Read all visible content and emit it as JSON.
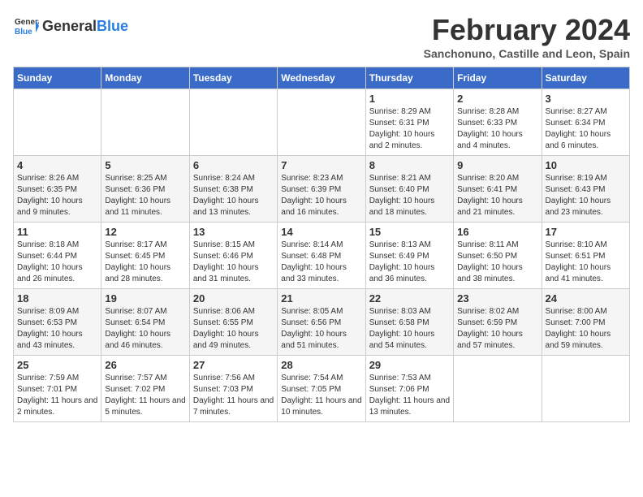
{
  "logo": {
    "general": "General",
    "blue": "Blue"
  },
  "header": {
    "month": "February 2024",
    "location": "Sanchonuno, Castille and Leon, Spain"
  },
  "days_of_week": [
    "Sunday",
    "Monday",
    "Tuesday",
    "Wednesday",
    "Thursday",
    "Friday",
    "Saturday"
  ],
  "weeks": [
    [
      {
        "day": "",
        "info": ""
      },
      {
        "day": "",
        "info": ""
      },
      {
        "day": "",
        "info": ""
      },
      {
        "day": "",
        "info": ""
      },
      {
        "day": "1",
        "info": "Sunrise: 8:29 AM\nSunset: 6:31 PM\nDaylight: 10 hours and 2 minutes."
      },
      {
        "day": "2",
        "info": "Sunrise: 8:28 AM\nSunset: 6:33 PM\nDaylight: 10 hours and 4 minutes."
      },
      {
        "day": "3",
        "info": "Sunrise: 8:27 AM\nSunset: 6:34 PM\nDaylight: 10 hours and 6 minutes."
      }
    ],
    [
      {
        "day": "4",
        "info": "Sunrise: 8:26 AM\nSunset: 6:35 PM\nDaylight: 10 hours and 9 minutes."
      },
      {
        "day": "5",
        "info": "Sunrise: 8:25 AM\nSunset: 6:36 PM\nDaylight: 10 hours and 11 minutes."
      },
      {
        "day": "6",
        "info": "Sunrise: 8:24 AM\nSunset: 6:38 PM\nDaylight: 10 hours and 13 minutes."
      },
      {
        "day": "7",
        "info": "Sunrise: 8:23 AM\nSunset: 6:39 PM\nDaylight: 10 hours and 16 minutes."
      },
      {
        "day": "8",
        "info": "Sunrise: 8:21 AM\nSunset: 6:40 PM\nDaylight: 10 hours and 18 minutes."
      },
      {
        "day": "9",
        "info": "Sunrise: 8:20 AM\nSunset: 6:41 PM\nDaylight: 10 hours and 21 minutes."
      },
      {
        "day": "10",
        "info": "Sunrise: 8:19 AM\nSunset: 6:43 PM\nDaylight: 10 hours and 23 minutes."
      }
    ],
    [
      {
        "day": "11",
        "info": "Sunrise: 8:18 AM\nSunset: 6:44 PM\nDaylight: 10 hours and 26 minutes."
      },
      {
        "day": "12",
        "info": "Sunrise: 8:17 AM\nSunset: 6:45 PM\nDaylight: 10 hours and 28 minutes."
      },
      {
        "day": "13",
        "info": "Sunrise: 8:15 AM\nSunset: 6:46 PM\nDaylight: 10 hours and 31 minutes."
      },
      {
        "day": "14",
        "info": "Sunrise: 8:14 AM\nSunset: 6:48 PM\nDaylight: 10 hours and 33 minutes."
      },
      {
        "day": "15",
        "info": "Sunrise: 8:13 AM\nSunset: 6:49 PM\nDaylight: 10 hours and 36 minutes."
      },
      {
        "day": "16",
        "info": "Sunrise: 8:11 AM\nSunset: 6:50 PM\nDaylight: 10 hours and 38 minutes."
      },
      {
        "day": "17",
        "info": "Sunrise: 8:10 AM\nSunset: 6:51 PM\nDaylight: 10 hours and 41 minutes."
      }
    ],
    [
      {
        "day": "18",
        "info": "Sunrise: 8:09 AM\nSunset: 6:53 PM\nDaylight: 10 hours and 43 minutes."
      },
      {
        "day": "19",
        "info": "Sunrise: 8:07 AM\nSunset: 6:54 PM\nDaylight: 10 hours and 46 minutes."
      },
      {
        "day": "20",
        "info": "Sunrise: 8:06 AM\nSunset: 6:55 PM\nDaylight: 10 hours and 49 minutes."
      },
      {
        "day": "21",
        "info": "Sunrise: 8:05 AM\nSunset: 6:56 PM\nDaylight: 10 hours and 51 minutes."
      },
      {
        "day": "22",
        "info": "Sunrise: 8:03 AM\nSunset: 6:58 PM\nDaylight: 10 hours and 54 minutes."
      },
      {
        "day": "23",
        "info": "Sunrise: 8:02 AM\nSunset: 6:59 PM\nDaylight: 10 hours and 57 minutes."
      },
      {
        "day": "24",
        "info": "Sunrise: 8:00 AM\nSunset: 7:00 PM\nDaylight: 10 hours and 59 minutes."
      }
    ],
    [
      {
        "day": "25",
        "info": "Sunrise: 7:59 AM\nSunset: 7:01 PM\nDaylight: 11 hours and 2 minutes."
      },
      {
        "day": "26",
        "info": "Sunrise: 7:57 AM\nSunset: 7:02 PM\nDaylight: 11 hours and 5 minutes."
      },
      {
        "day": "27",
        "info": "Sunrise: 7:56 AM\nSunset: 7:03 PM\nDaylight: 11 hours and 7 minutes."
      },
      {
        "day": "28",
        "info": "Sunrise: 7:54 AM\nSunset: 7:05 PM\nDaylight: 11 hours and 10 minutes."
      },
      {
        "day": "29",
        "info": "Sunrise: 7:53 AM\nSunset: 7:06 PM\nDaylight: 11 hours and 13 minutes."
      },
      {
        "day": "",
        "info": ""
      },
      {
        "day": "",
        "info": ""
      }
    ]
  ]
}
